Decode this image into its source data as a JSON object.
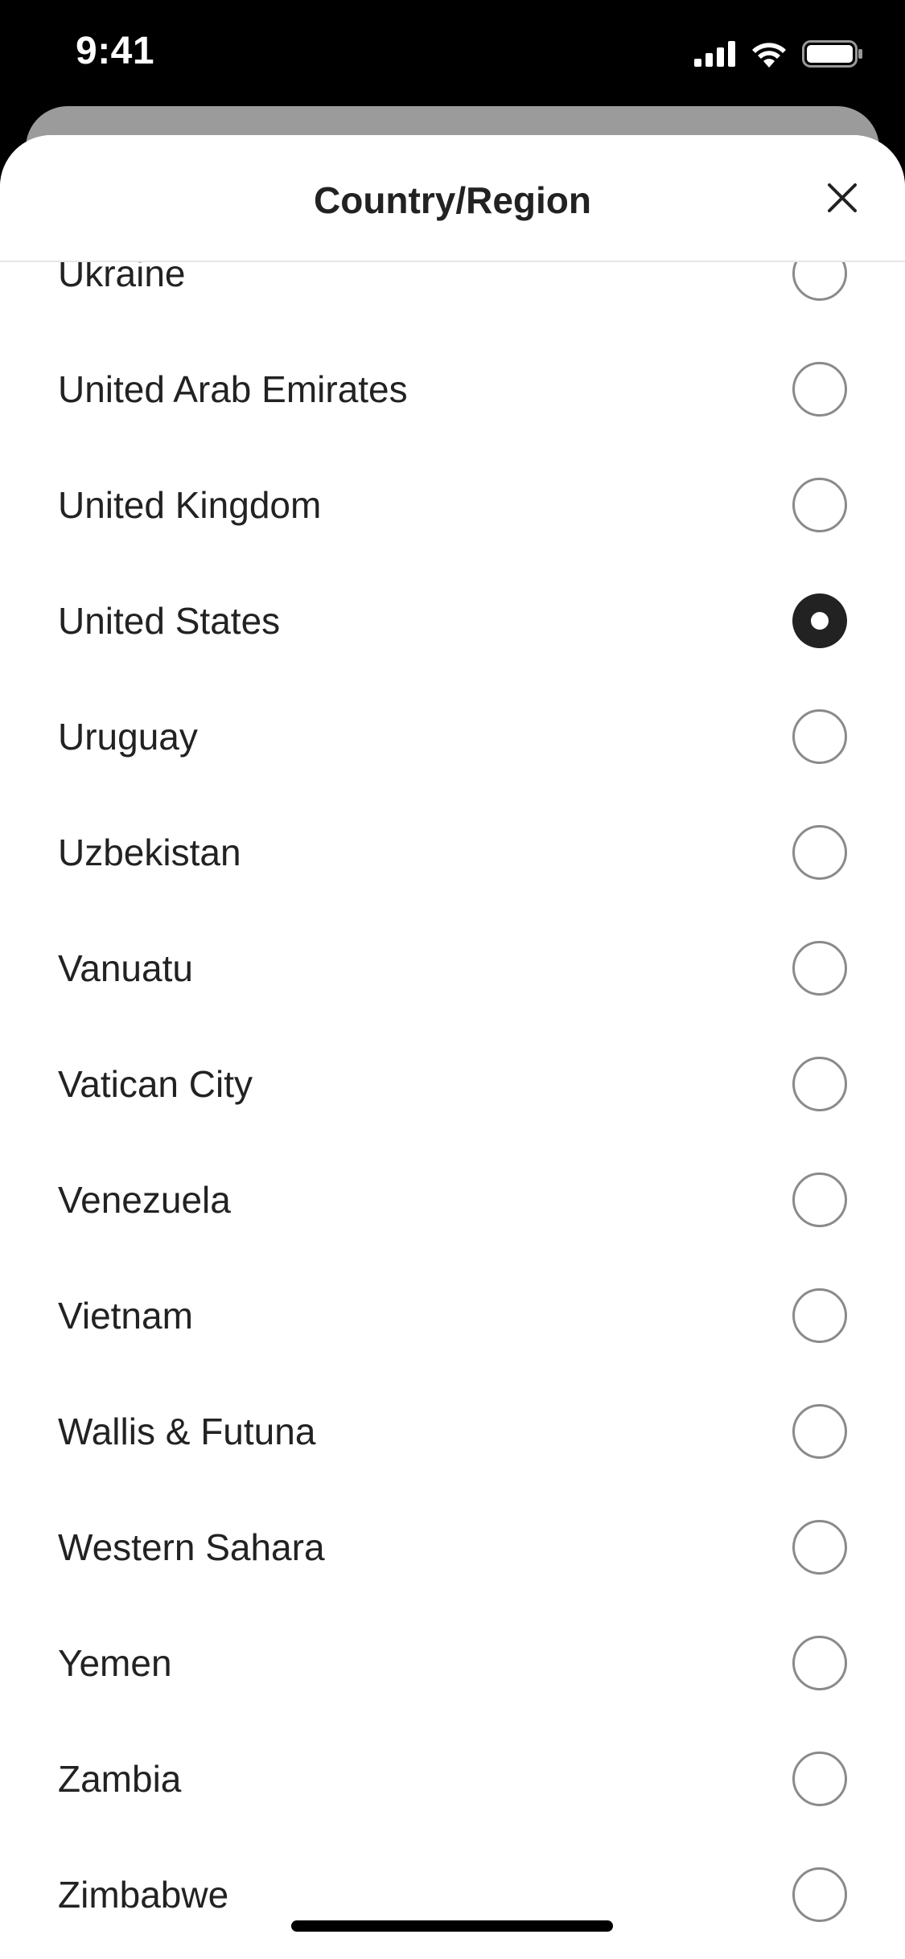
{
  "status_bar": {
    "time": "9:41",
    "icons": [
      "cellular-signal-icon",
      "wifi-icon",
      "battery-icon"
    ]
  },
  "sheet": {
    "title": "Country/Region",
    "close_icon": "close-icon"
  },
  "countries": [
    {
      "label": "Ukraine",
      "selected": false
    },
    {
      "label": "United Arab Emirates",
      "selected": false
    },
    {
      "label": "United Kingdom",
      "selected": false
    },
    {
      "label": "United States",
      "selected": true
    },
    {
      "label": "Uruguay",
      "selected": false
    },
    {
      "label": "Uzbekistan",
      "selected": false
    },
    {
      "label": "Vanuatu",
      "selected": false
    },
    {
      "label": "Vatican City",
      "selected": false
    },
    {
      "label": "Venezuela",
      "selected": false
    },
    {
      "label": "Vietnam",
      "selected": false
    },
    {
      "label": "Wallis & Futuna",
      "selected": false
    },
    {
      "label": "Western Sahara",
      "selected": false
    },
    {
      "label": "Yemen",
      "selected": false
    },
    {
      "label": "Zambia",
      "selected": false
    },
    {
      "label": "Zimbabwe",
      "selected": false
    }
  ],
  "colors": {
    "text": "#222222",
    "radio_border": "#8a8a8a",
    "selected": "#222222",
    "divider": "#e6e6e6",
    "backdrop": "#9b9b9b"
  }
}
